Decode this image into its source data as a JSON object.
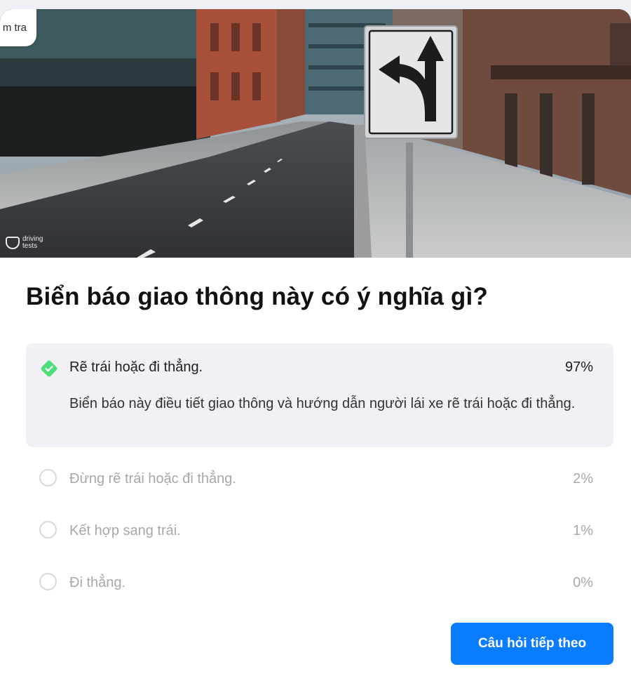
{
  "tab_label": "m tra",
  "image": {
    "brand_line1": "driving",
    "brand_line2": "tests",
    "logo_icon": "drivingtests-logo-icon",
    "sign_icon": "turn-left-or-straight-sign-icon"
  },
  "question": "Biển báo giao thông này có ý nghĩa gì?",
  "options": [
    {
      "label": "Rẽ trái hoặc đi thẳng.",
      "percent": "97%",
      "correct": true,
      "explanation": "Biển báo này điều tiết giao thông và hướng dẫn người lái xe rẽ trái hoặc đi thẳng.",
      "icon": "check-diamond-icon"
    },
    {
      "label": "Đừng rẽ trái hoặc đi thẳng.",
      "percent": "2%",
      "correct": false,
      "icon": "radio-circle-icon"
    },
    {
      "label": "Kết hợp sang trái.",
      "percent": "1%",
      "correct": false,
      "icon": "radio-circle-icon"
    },
    {
      "label": "Đi thẳng.",
      "percent": "0%",
      "correct": false,
      "icon": "radio-circle-icon"
    }
  ],
  "next_button": "Câu hỏi tiếp theo",
  "colors": {
    "accent": "#0a7cff",
    "correct": "#4ede7a",
    "correct_bg": "#f1f1f5"
  }
}
